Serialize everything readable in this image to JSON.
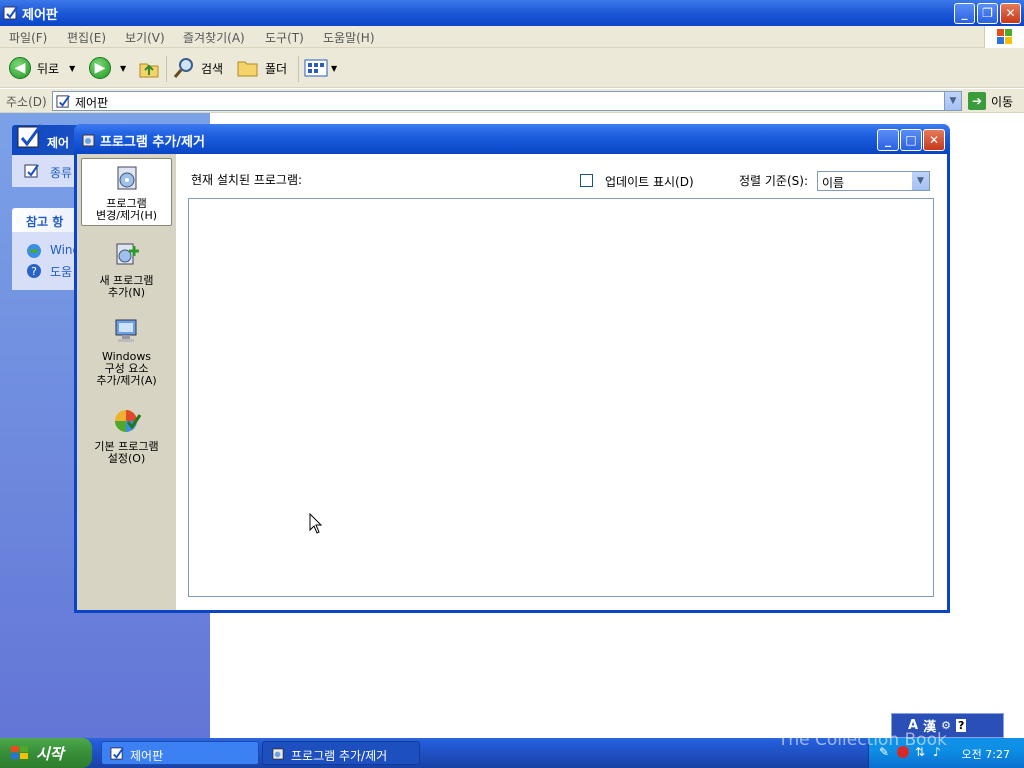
{
  "window": {
    "title": "제어판",
    "menu": [
      "파일(F)",
      "편집(E)",
      "보기(V)",
      "즐겨찾기(A)",
      "도구(T)",
      "도움말(H)"
    ],
    "toolbar": {
      "back": "뒤로",
      "search": "검색",
      "folders": "폴더"
    },
    "address": {
      "label": "주소(D)",
      "value": "제어판",
      "go": "이동"
    }
  },
  "left_pane": {
    "panel_title": "제어",
    "switch_view": "종류",
    "see_also_title": "참고 항",
    "links": [
      "Winc",
      "도움"
    ]
  },
  "dialog": {
    "title": "프로그램 추가/제거",
    "sidebar": [
      {
        "label": "프로그램\n변경/제거(H)",
        "icon": "change-remove-programs-icon"
      },
      {
        "label": "새 프로그램\n추가(N)",
        "icon": "add-new-programs-icon"
      },
      {
        "label": "Windows\n구성 요소\n추가/제거(A)",
        "icon": "windows-components-icon"
      },
      {
        "label": "기본 프로그램\n설정(O)",
        "icon": "default-programs-icon"
      }
    ],
    "installed_label": "현재 설치된 프로그램:",
    "show_updates_label": "업데이트 표시(D)",
    "show_updates_checked": false,
    "sort_label": "정렬 기준(S):",
    "sort_value": "이름"
  },
  "ime": {
    "mode": "A",
    "hanja": "漢"
  },
  "taskbar": {
    "start": "시작",
    "items": [
      "제어판",
      "프로그램 추가/제거"
    ],
    "clock": "오전 7:27",
    "watermark": "The Collection Book"
  },
  "colors": {
    "titlebar": "#0a45c7",
    "taskbar": "#245edb",
    "start": "#388e38",
    "dialog_side": "#d8d4c3"
  }
}
